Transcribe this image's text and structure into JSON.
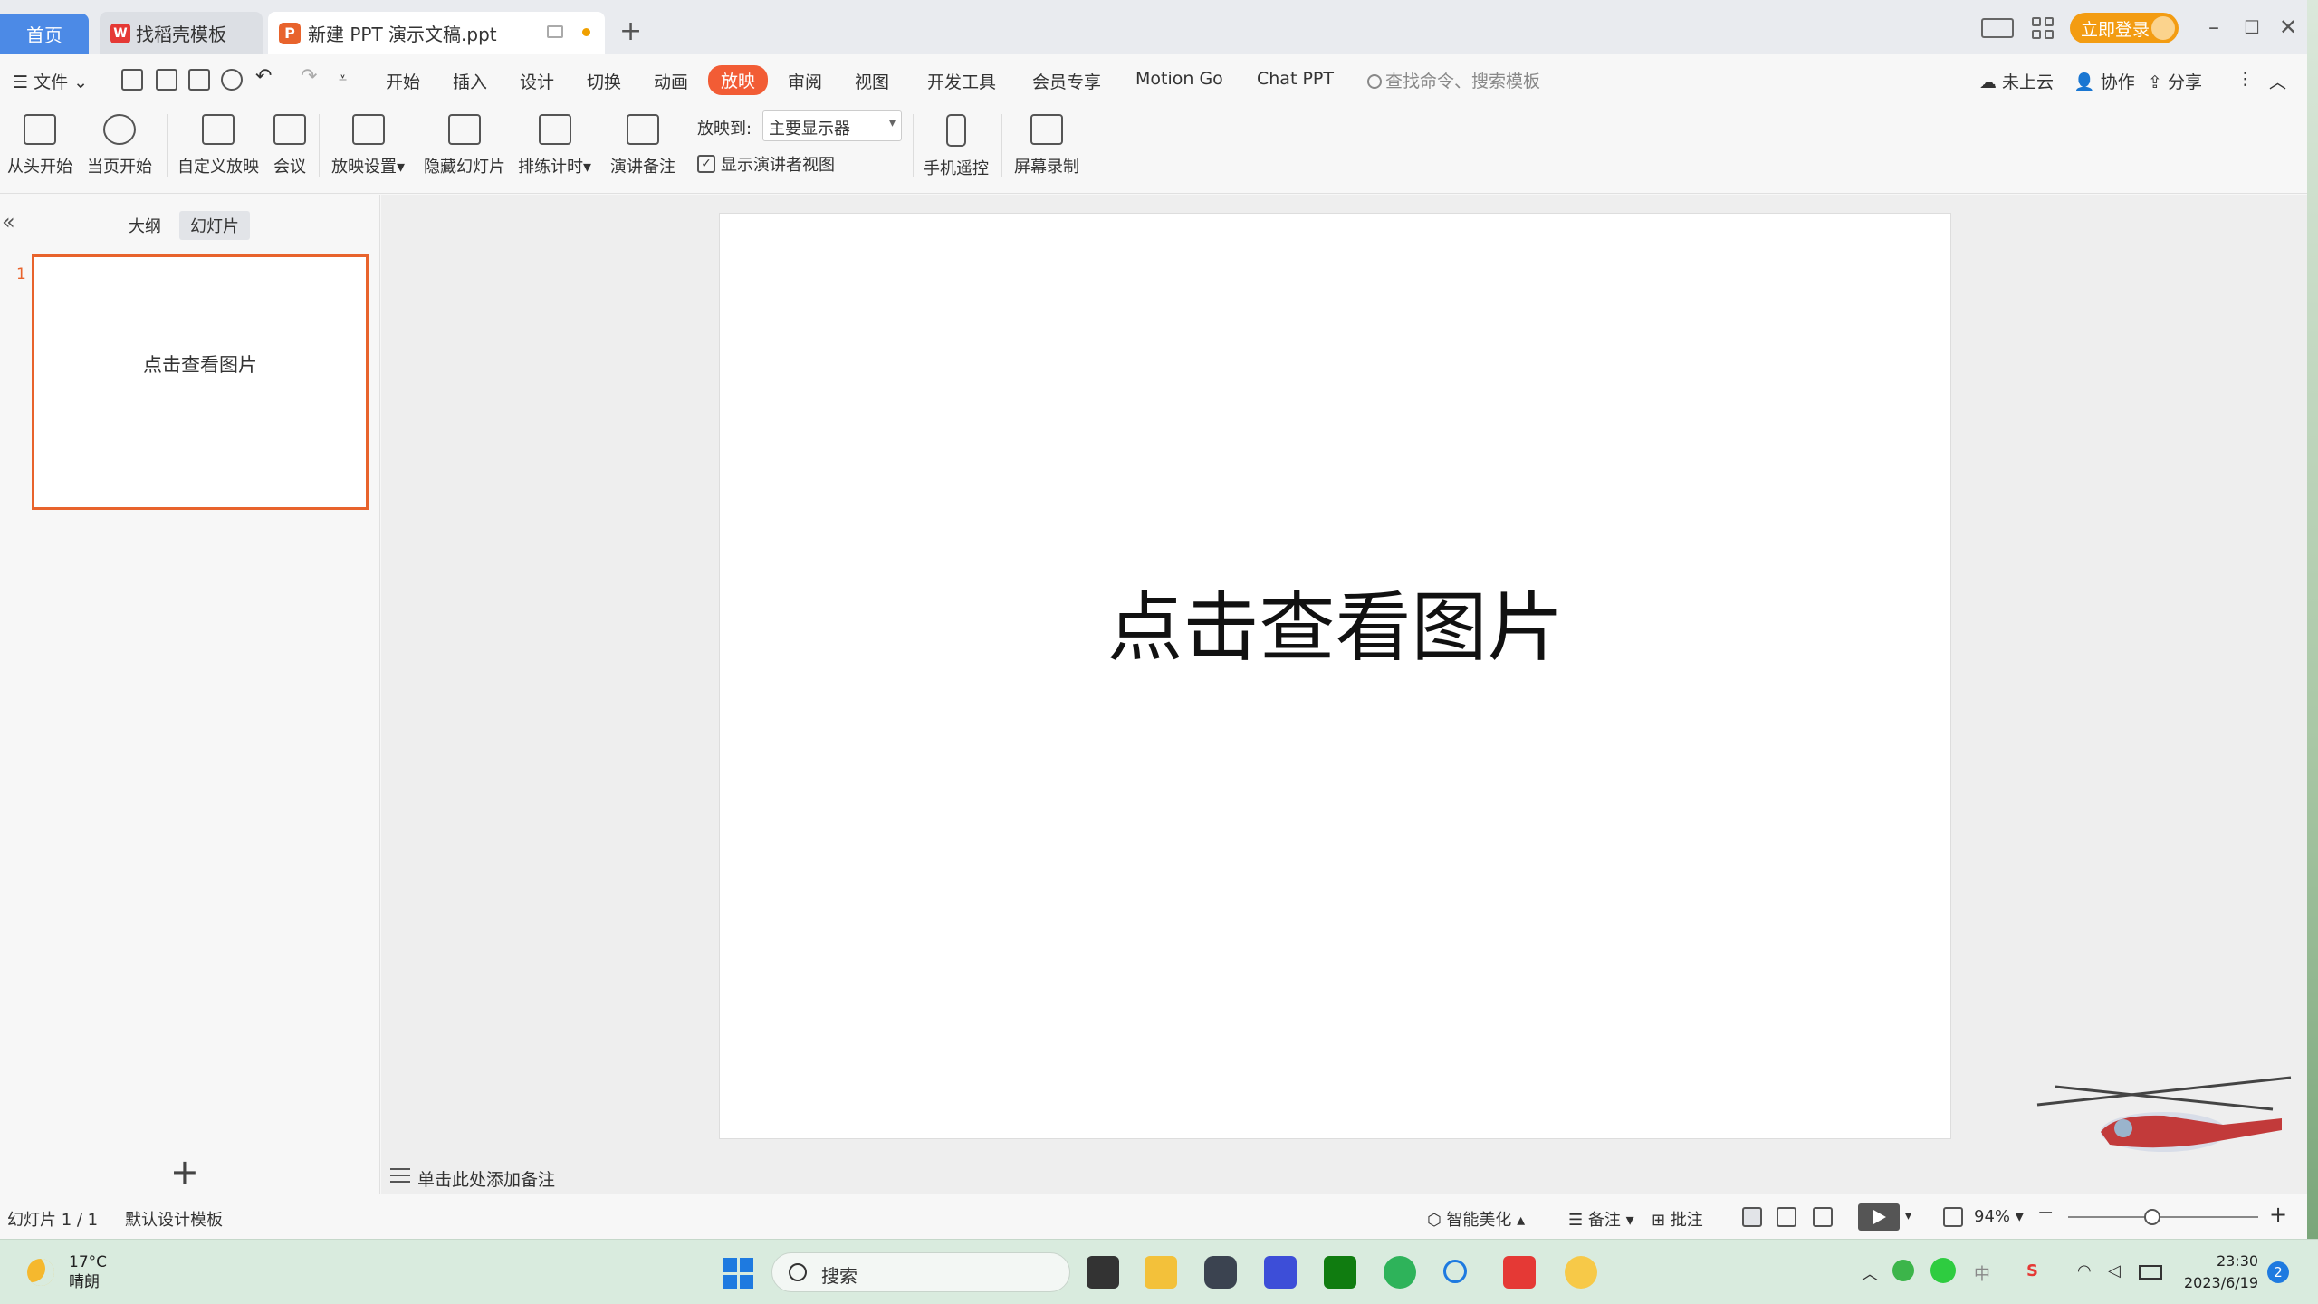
{
  "titlebar": {
    "tabs": [
      {
        "label": "首页"
      },
      {
        "label": "找稻壳模板"
      },
      {
        "label": "新建 PPT 演示文稿.ppt"
      }
    ],
    "new_tab": "+",
    "login": "立即登录"
  },
  "menu": {
    "file": "文件",
    "items": [
      "开始",
      "插入",
      "设计",
      "切换",
      "动画",
      "放映",
      "审阅",
      "视图",
      "开发工具",
      "会员专享",
      "Motion Go",
      "Chat PPT"
    ],
    "active": "放映",
    "search_placeholder": "查找命令、搜索模板",
    "cloud": "未上云",
    "collab": "协作",
    "share": "分享"
  },
  "ribbon": {
    "from_start": "从头开始",
    "from_current": "当页开始",
    "custom_show": "自定义放映",
    "meeting": "会议",
    "show_settings": "放映设置",
    "hide_slide": "隐藏幻灯片",
    "rehearse": "排练计时",
    "speaker_notes": "演讲备注",
    "play_to_label": "放映到:",
    "play_to_value": "主要显示器",
    "presenter_view": "显示演讲者视图",
    "phone_remote": "手机遥控",
    "screen_record": "屏幕录制"
  },
  "left_panel": {
    "tab_outline": "大纲",
    "tab_slides": "幻灯片",
    "slide_number": "1",
    "thumb_text": "点击查看图片"
  },
  "slide": {
    "text": "点击查看图片"
  },
  "notes_placeholder": "单击此处添加备注",
  "statusbar": {
    "slide_info": "幻灯片 1 / 1",
    "template": "默认设计模板",
    "beautify": "智能美化",
    "notes": "备注",
    "comments": "批注",
    "zoom": "94%",
    "zoom_level": 0.4
  },
  "taskbar": {
    "temp": "17°C",
    "weather": "晴朗",
    "search": "搜索",
    "time": "23:30",
    "date": "2023/6/19",
    "notification_count": "2",
    "ime": "中"
  },
  "colors": {
    "accent": "#f25c35",
    "home_tab": "#4c8ae6",
    "login": "#f39c12"
  }
}
